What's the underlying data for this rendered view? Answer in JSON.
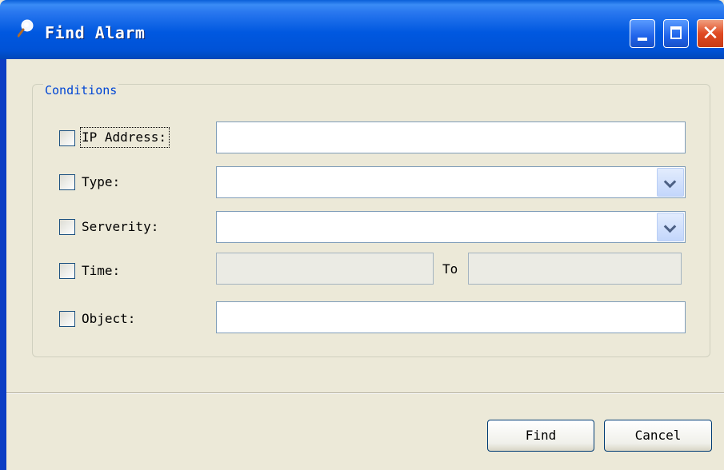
{
  "window": {
    "title": "Find Alarm",
    "icons": {
      "title": "magnifier-icon",
      "minimize": "minimize-icon",
      "maximize": "maximize-icon",
      "close": "close-icon"
    },
    "accent": "#0055e5"
  },
  "conditions": {
    "title": "Conditions",
    "ip_address": {
      "label": "IP Address:",
      "value": "",
      "checked": false
    },
    "type": {
      "label": "Type:",
      "value": "",
      "checked": false
    },
    "severity": {
      "label": "Serverity:",
      "value": "",
      "checked": false
    },
    "time": {
      "label": "Time:",
      "from": "",
      "to_label": "To",
      "to": "",
      "checked": false
    },
    "object": {
      "label": "Object:",
      "value": "",
      "checked": false
    }
  },
  "buttons": {
    "find": "Find",
    "cancel": "Cancel"
  }
}
